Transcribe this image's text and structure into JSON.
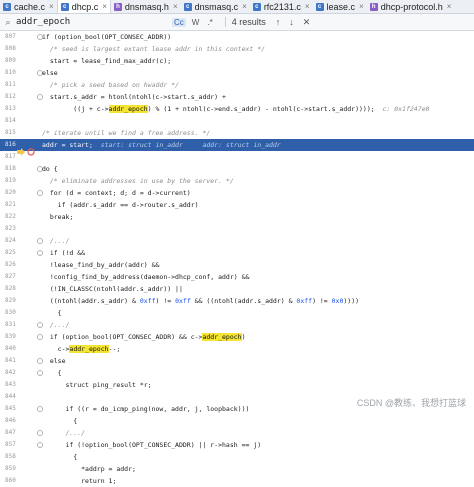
{
  "tabs": [
    {
      "label": "cache.c",
      "type": "c",
      "active": false
    },
    {
      "label": "dhcp.c",
      "type": "c",
      "active": true
    },
    {
      "label": "dnsmasq.h",
      "type": "h",
      "active": false
    },
    {
      "label": "dnsmasq.c",
      "type": "c",
      "active": false
    },
    {
      "label": "rfc2131.c",
      "type": "c",
      "active": false
    },
    {
      "label": "lease.c",
      "type": "c",
      "active": false
    },
    {
      "label": "dhcp-protocol.h",
      "type": "h",
      "active": false
    }
  ],
  "find": {
    "query": "addr_epoch",
    "option_case": "Cc",
    "option_word": "W",
    "option_regex": ".*",
    "results": "4 results",
    "prev": "↑",
    "next": "↓",
    "close": "✕"
  },
  "code_lines": [
    {
      "n": "807",
      "html": "if (option_bool(OPT_CONSEC_ADDR))"
    },
    {
      "n": "808",
      "html": "  <span class='cm'>/* seed is largest extant lease addr in this context */</span>"
    },
    {
      "n": "809",
      "html": "  start = lease_find_max_addr(c);"
    },
    {
      "n": "810",
      "html": "else"
    },
    {
      "n": "811",
      "html": "  <span class='cm'>/* pick a seed based on hwaddr */</span>"
    },
    {
      "n": "812",
      "html": "  start.s_addr = htonl(ntohl(c-&gt;start.s_addr) +"
    },
    {
      "n": "813",
      "html": "        ((j + c-&gt;<span class='hl'>addr_epoch</span>) % (1 + ntohl(c-&gt;end.s_addr) - ntohl(c-&gt;start.s_addr))));  <span class='hint'>c: 0x1f247e0</span>"
    },
    {
      "n": "814",
      "html": ""
    },
    {
      "n": "815",
      "html": "<span class='cm'>/* iterate until we find a free address. */</span>"
    },
    {
      "n": "816",
      "html": "addr = start;  <span class='hint'>start: struct in_addr     addr: struct in_addr</span>",
      "selected": true
    },
    {
      "n": "817",
      "html": ""
    },
    {
      "n": "818",
      "html": "do {"
    },
    {
      "n": "819",
      "html": "  <span class='cm'>/* eliminate addresses in use by the server. */</span>"
    },
    {
      "n": "820",
      "html": "  for (d = context; d; d = d-&gt;current)"
    },
    {
      "n": "821",
      "html": "    if (addr.s_addr == d-&gt;router.s_addr)"
    },
    {
      "n": "822",
      "html": "  break;"
    },
    {
      "n": "823",
      "html": ""
    },
    {
      "n": "824",
      "html": "  <span class='cm'>/.../</span>"
    },
    {
      "n": "825",
      "html": "  if (!d &amp;&amp;"
    },
    {
      "n": "826",
      "html": "  !lease_find_by_addr(addr) &amp;&amp;"
    },
    {
      "n": "827",
      "html": "  !config_find_by_address(daemon-&gt;dhcp_conf, addr) &amp;&amp;"
    },
    {
      "n": "828",
      "html": "  (!IN_CLASSC(ntohl(addr.s_addr)) ||"
    },
    {
      "n": "829",
      "html": "  ((ntohl(addr.s_addr) &amp; <span class='num'>0xff</span>) != <span class='num'>0xff</span> &amp;&amp; ((ntohl(addr.s_addr) &amp; <span class='num'>0xff</span>) != <span class='num'>0x0</span>))))"
    },
    {
      "n": "830",
      "html": "    {"
    },
    {
      "n": "831",
      "html": "  <span class='cm'>/.../</span>"
    },
    {
      "n": "839",
      "html": "  if (option_bool(OPT_CONSEC_ADDR) &amp;&amp; c-&gt;<span class='hl'>addr_epoch</span>)"
    },
    {
      "n": "840",
      "html": "    c-&gt;<span class='hl'>addr_epoch</span>--;"
    },
    {
      "n": "841",
      "html": "  else"
    },
    {
      "n": "842",
      "html": "    {"
    },
    {
      "n": "843",
      "html": "      struct ping_result *r;"
    },
    {
      "n": "844",
      "html": ""
    },
    {
      "n": "845",
      "html": "      if ((r = do_icmp_ping(now, addr, j, loopback)))"
    },
    {
      "n": "846",
      "html": "        {"
    },
    {
      "n": "847",
      "html": "      <span class='cm'>/.../</span>"
    },
    {
      "n": "857",
      "html": "      if (!option_bool(OPT_CONSEC_ADDR) || r-&gt;hash == j)"
    },
    {
      "n": "858",
      "html": "        {"
    },
    {
      "n": "859",
      "html": "          *addrp = addr;"
    },
    {
      "n": "860",
      "html": "          return 1;"
    }
  ],
  "watermark": "CSDN @教练、我想打篮球"
}
